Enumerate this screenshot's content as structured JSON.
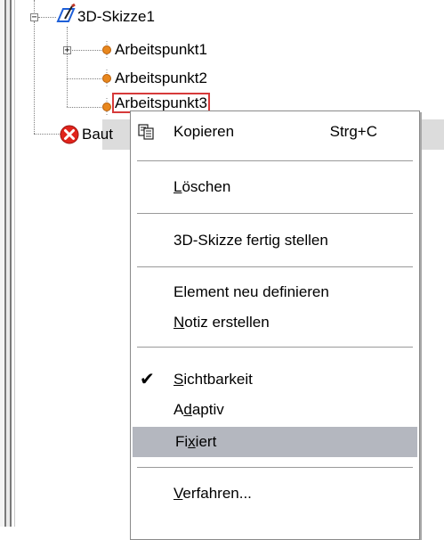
{
  "tree": {
    "sketch_label": "3D-Skizze1",
    "workpoints": [
      "Arbeitspunkt1",
      "Arbeitspunkt2",
      "Arbeitspunkt3"
    ],
    "baut_label": "Baut",
    "expander_minus": "−",
    "expander_plus": "+"
  },
  "context_menu": {
    "copy": {
      "label": "Kopieren",
      "shortcut": "Strg+C"
    },
    "delete": {
      "pre": "",
      "ul": "L",
      "post": "öschen"
    },
    "finish_sketch": {
      "label": "3D-Skizze fertig stellen"
    },
    "redefine": {
      "label": "Element neu definieren"
    },
    "note": {
      "pre": "",
      "ul": "N",
      "post": "otiz erstellen"
    },
    "visibility": {
      "pre": "",
      "ul": "S",
      "post": "ichtbarkeit",
      "checked": true,
      "check_glyph": "✔"
    },
    "adaptive": {
      "pre": "A",
      "ul": "d",
      "post": "aptiv"
    },
    "fixed": {
      "pre": "Fi",
      "ul": "x",
      "post": "iert"
    },
    "procedure": {
      "pre": "",
      "ul": "V",
      "post": "erfahren..."
    }
  },
  "colors": {
    "highlight": "#b4b7bf",
    "selection_border": "#d63a3a",
    "workpoint": "#e8871e",
    "error": "#e0241c"
  }
}
